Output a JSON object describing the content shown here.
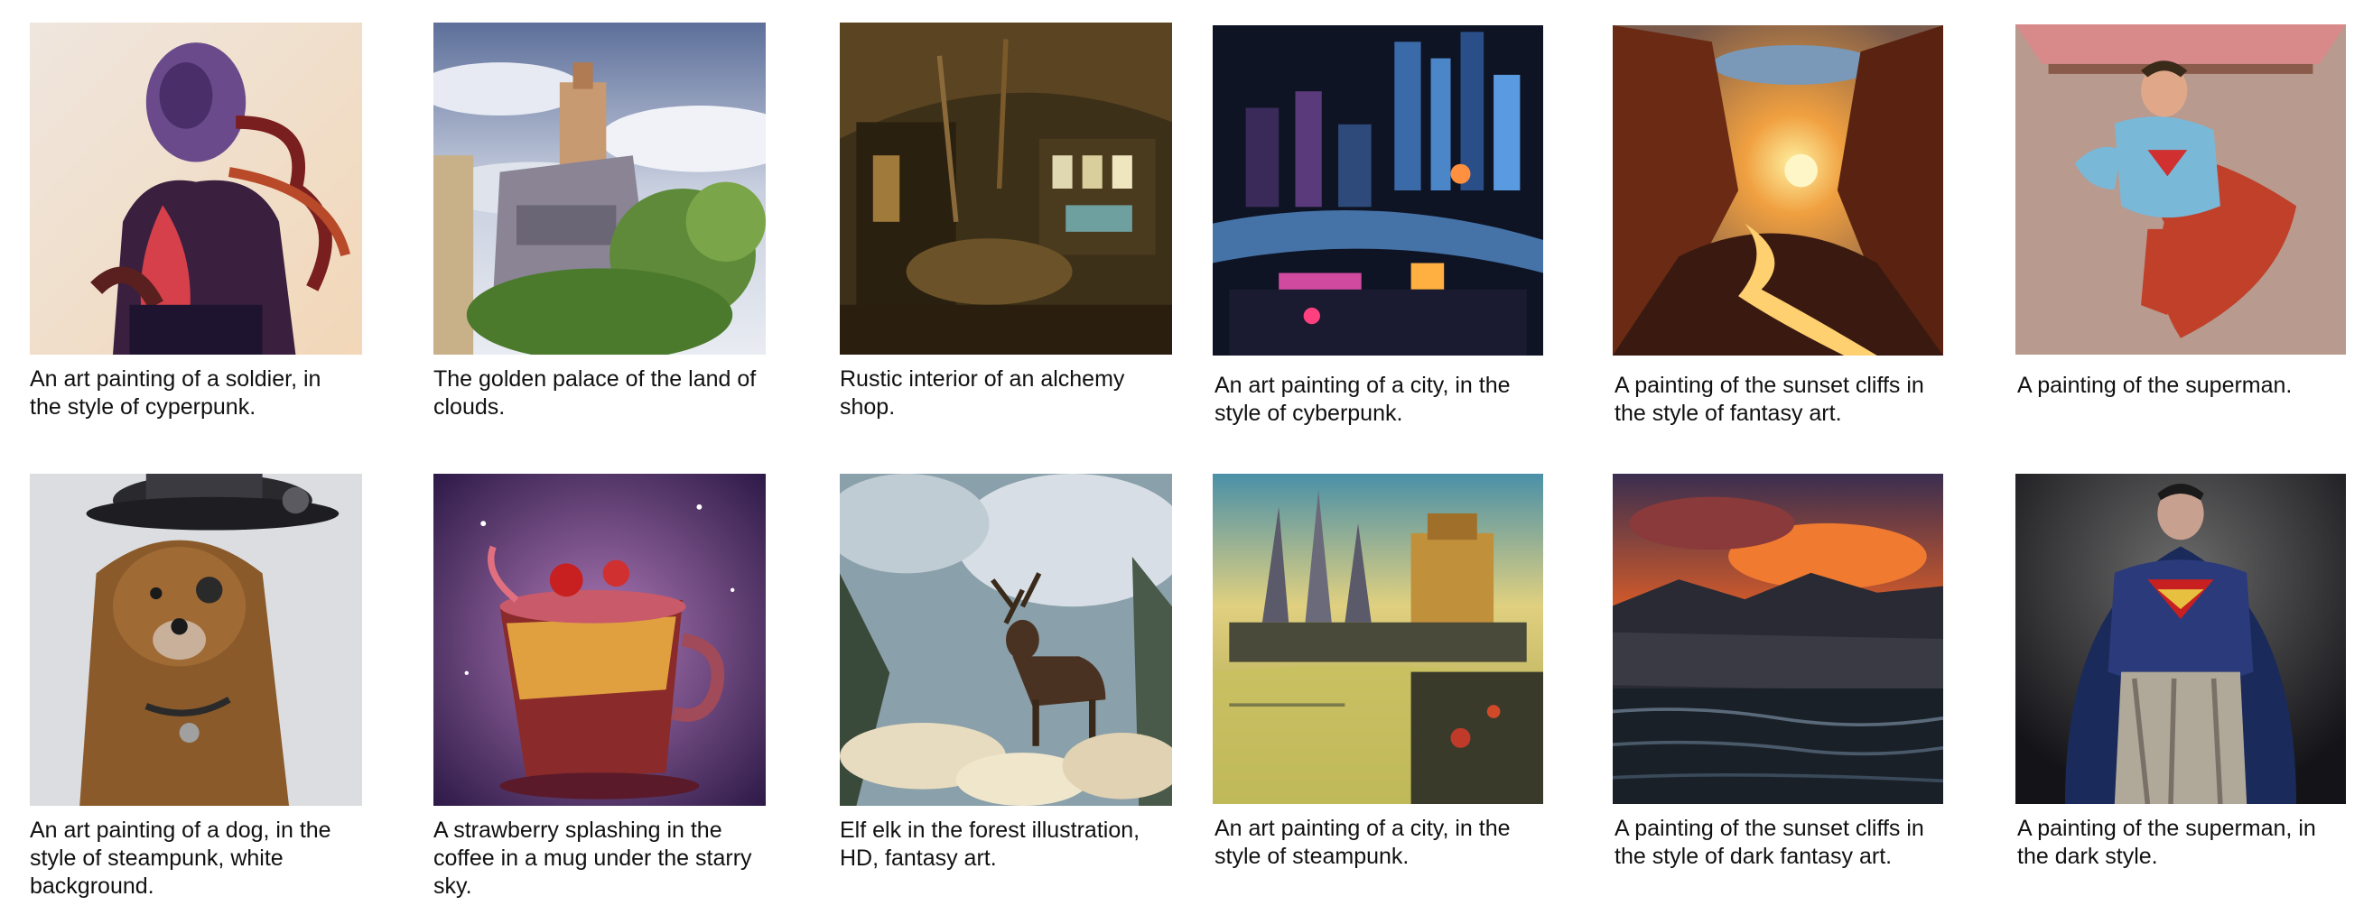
{
  "gallery": {
    "items": [
      {
        "caption": "An art painting of a soldier, in the style of cyperpunk.",
        "image": "cyberpunk-soldier"
      },
      {
        "caption": "The golden palace of the land of clouds.",
        "image": "cloud-palace"
      },
      {
        "caption": "Rustic interior of an alchemy shop.",
        "image": "alchemy-shop"
      },
      {
        "caption": "An art painting of a city, in the style of cyberpunk.",
        "image": "cyberpunk-city"
      },
      {
        "caption": "A painting of the sunset cliffs in the style of fantasy art.",
        "image": "sunset-cliffs"
      },
      {
        "caption": "A painting of the superman.",
        "image": "superman"
      },
      {
        "caption": "An art painting of a dog, in the style of steampunk, white background.",
        "image": "steampunk-dog"
      },
      {
        "caption": "A strawberry splashing in the coffee in a mug under the starry sky.",
        "image": "strawberry-mug"
      },
      {
        "caption": "Elf elk in the forest illustration, HD, fantasy art.",
        "image": "elf-elk"
      },
      {
        "caption": "An art painting of a city, in the style of steampunk.",
        "image": "steampunk-city"
      },
      {
        "caption": "A painting of the sunset cliffs in the style of dark fantasy art.",
        "image": "dark-sunset-cliffs"
      },
      {
        "caption": "A painting of the superman, in the dark style.",
        "image": "dark-superman"
      }
    ]
  }
}
